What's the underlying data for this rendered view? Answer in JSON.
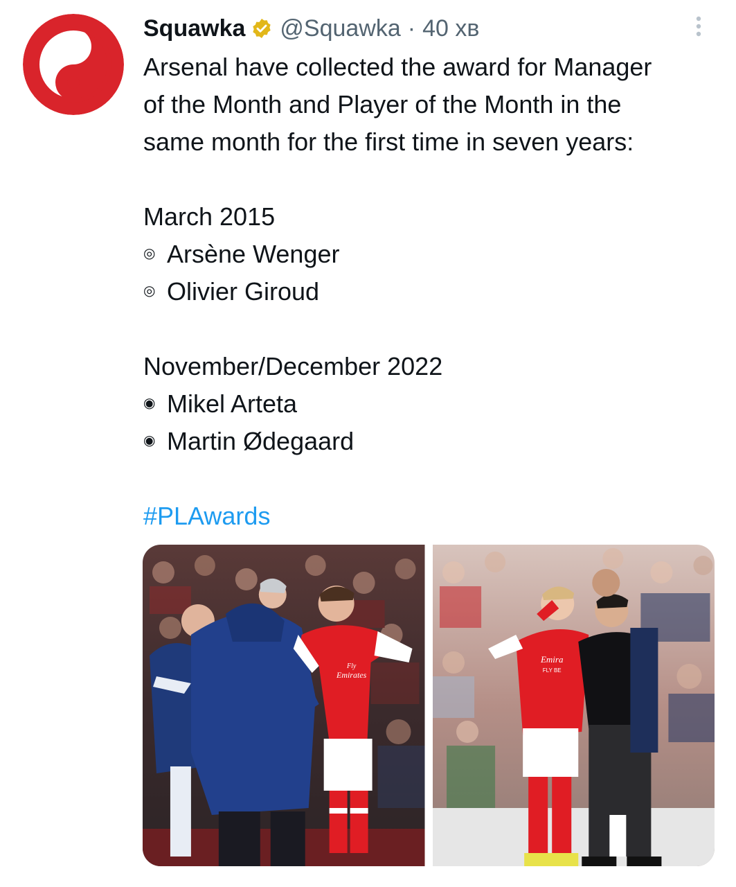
{
  "tweet": {
    "display_name": "Squawka",
    "handle": "@Squawka",
    "separator": "·",
    "time": "40 хв",
    "text_lines": [
      "Arsenal have collected the award for Manager",
      "of the Month and Player of the Month in the",
      "same month for the first time in seven years:"
    ],
    "sections": [
      {
        "heading": "March 2015",
        "bullet_symbol": "◎",
        "items": [
          "Arsène Wenger",
          "Olivier Giroud"
        ]
      },
      {
        "heading": "November/December 2022",
        "bullet_symbol": "◉",
        "items": [
          "Mikel Arteta",
          "Martin Ødegaard"
        ]
      }
    ],
    "hashtag": "#PLAwards"
  },
  "images": {
    "left": {
      "kit_text_line1": "Fly",
      "kit_text_line2": "Emirates"
    },
    "right": {
      "kit_text_line1": "Emira",
      "kit_text_line2": "FLY BE"
    }
  },
  "colors": {
    "brand_red": "#d9242b",
    "verified_gold": "#e2b719",
    "link_blue": "#1d9bf0",
    "meta_gray": "#536471"
  },
  "icons": {
    "avatar": "squawka-logo",
    "verified": "verified-badge-icon",
    "more": "more-vertical-icon"
  }
}
